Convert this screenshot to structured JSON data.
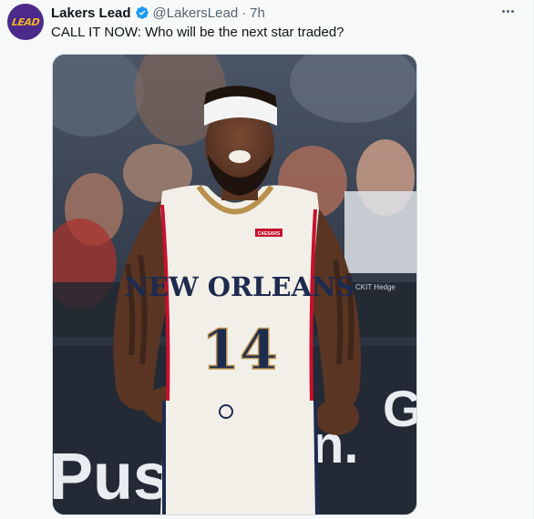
{
  "post": {
    "avatar": {
      "text": "LEAD",
      "icon": "lakers-lead-logo"
    },
    "display_name": "Lakers Lead",
    "handle": "@LakersLead",
    "separator": "·",
    "time": "7h",
    "verified_icon": "verified-badge-icon",
    "more_icon": "more-options-icon",
    "text": "CALL IT NOW: Who will be the next star traded?"
  },
  "media": {
    "jersey_city": "NEW ORLEANS",
    "jersey_number": "14",
    "jersey_patch": "CAESARS",
    "board_text": "Push",
    "board_text_right": "n.",
    "board_letter": "G",
    "courtside_text": "CKIT Hedge",
    "colors": {
      "navy": "#1d2b4f",
      "gold": "#b8914d",
      "jersey": "#f2efe8",
      "red": "#c8102e"
    }
  }
}
